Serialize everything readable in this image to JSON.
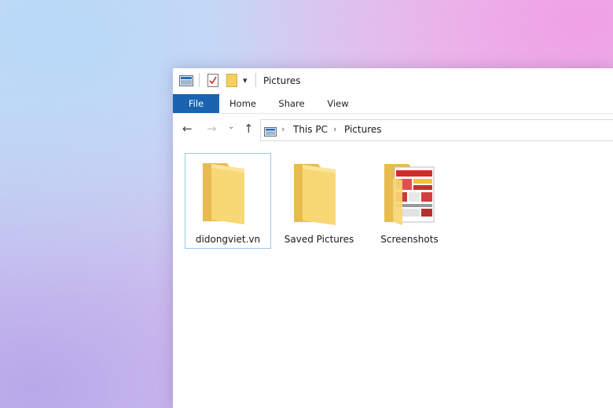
{
  "window": {
    "title": "Pictures",
    "ribbon_tabs": [
      "File",
      "Home",
      "Share",
      "View"
    ],
    "address": {
      "crumbs": [
        "This PC",
        "Pictures"
      ]
    }
  },
  "items": [
    {
      "name": "didongviet.vn",
      "selected": true,
      "icon": "folder-icon"
    },
    {
      "name": "Saved Pictures",
      "selected": false,
      "icon": "folder-icon"
    },
    {
      "name": "Screenshots",
      "selected": false,
      "icon": "folder-with-preview-icon"
    }
  ],
  "colors": {
    "file_tab": "#1a63b0",
    "folder": "#f8d775",
    "selection_border": "#99c9ef"
  }
}
